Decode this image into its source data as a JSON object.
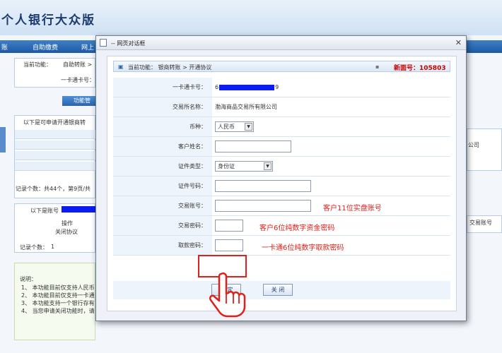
{
  "header": {
    "title": "个人银行大众版"
  },
  "nav": {
    "items": [
      "账",
      "自助缴费",
      "网上"
    ]
  },
  "background": {
    "current_func_label": "当前功能：",
    "current_func": "自助转账 >",
    "card_label": "一卡通卡号：",
    "tab": "功能管",
    "list_title": "以下是可申请开通银商转",
    "record_count": "记录个数：共44个，第9页/共",
    "account_title": "以下是账号",
    "col_op": "操作",
    "close_proto": "关闭协议",
    "right_col_1": "公司",
    "right_col_2": "交易账号",
    "record_count2": "记录个数：",
    "record_count2_val": "1",
    "notes_title": "说明：",
    "notes": [
      "1、 本功能目前仅支持人民币",
      "2、 本功能目前仅支持一卡通",
      "3、 本功能支持一个银行存有",
      "4、 当您申请关闭功能时，请"
    ]
  },
  "dialog": {
    "title": "-- 网页对话框",
    "close": "✕",
    "func_label": "当前功能：",
    "func_path": "银商转账 > 开通协议",
    "page_label": "新面号：",
    "page_no": "105803",
    "fields": {
      "card_label": "一卡通卡号：",
      "card_prefix": "6",
      "card_suffix": "9",
      "exchange_label": "交易所名称：",
      "exchange_value": "渤海商品交易所有限公司",
      "currency_label": "币种：",
      "currency_value": "人民币",
      "name_label": "客户姓名：",
      "id_type_label": "证件类型：",
      "id_type_value": "身份证",
      "id_no_label": "证件号码：",
      "trade_acct_label": "交易账号：",
      "trade_pwd_label": "交易密码：",
      "withdraw_pwd_label": "取款密码："
    },
    "annotations": {
      "trade_acct": "客户11位实盘账号",
      "trade_pwd": "客户6位纯数字资金密码",
      "withdraw_pwd": "一卡通6位纯数字取款密码"
    },
    "buttons": {
      "confirm": "确 定",
      "close": "关 闭"
    }
  },
  "colors": {
    "accent": "#2a64ad",
    "annotation": "#e0201a",
    "redaction": "#0a1cf2"
  }
}
